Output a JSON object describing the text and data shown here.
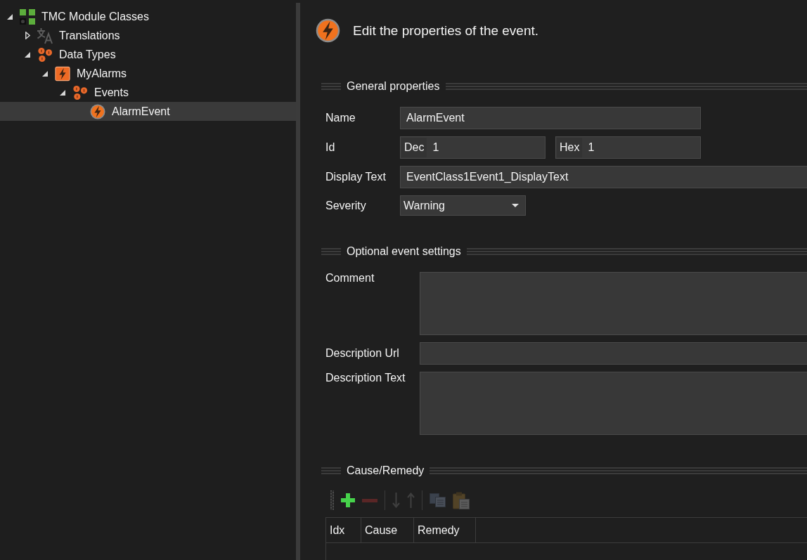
{
  "tree": {
    "items": [
      {
        "label": "TMC Module Classes",
        "kind": "modules",
        "expanded": true,
        "selected": false,
        "children": [
          {
            "label": "Translations",
            "kind": "translations",
            "expanded": false,
            "selected": false
          },
          {
            "label": "Data Types",
            "kind": "group",
            "expanded": true,
            "selected": false,
            "children": [
              {
                "label": "MyAlarms",
                "kind": "class",
                "expanded": true,
                "selected": false,
                "children": [
                  {
                    "label": "Events",
                    "kind": "group",
                    "expanded": true,
                    "selected": false,
                    "children": [
                      {
                        "label": "AlarmEvent",
                        "kind": "event",
                        "selected": true
                      }
                    ]
                  }
                ]
              }
            ]
          }
        ]
      }
    ]
  },
  "header": {
    "title": "Edit the properties of the event."
  },
  "sections": [
    {
      "title": "General properties",
      "fields": [
        {
          "kind": "text",
          "label": "Name",
          "value": "AlarmEvent"
        },
        {
          "kind": "id",
          "label": "Id",
          "parts": [
            {
              "prefix": "Dec",
              "value": "1"
            },
            {
              "prefix": "Hex",
              "value": "1"
            }
          ]
        },
        {
          "kind": "text",
          "label": "Display Text",
          "value": "EventClass1Event1_DisplayText"
        },
        {
          "kind": "select",
          "label": "Severity",
          "value": "Warning"
        }
      ]
    },
    {
      "title": "Optional event settings",
      "fields": [
        {
          "kind": "textarea",
          "label": "Comment"
        },
        {
          "kind": "text",
          "label": "Description Url"
        },
        {
          "kind": "textarea",
          "label": "Description Text"
        }
      ]
    },
    {
      "title": "Cause/Remedy",
      "toolbar": [
        [
          {
            "kind": "add",
            "disabled": false
          },
          {
            "kind": "remove",
            "disabled": true
          }
        ],
        [
          {
            "kind": "move-down",
            "disabled": true
          },
          {
            "kind": "move-up",
            "disabled": true
          }
        ],
        [
          {
            "kind": "copy",
            "disabled": true
          },
          {
            "kind": "paste",
            "disabled": true
          }
        ]
      ],
      "table": {
        "columns": [
          "Idx",
          "Cause",
          "Remedy"
        ]
      }
    }
  ]
}
